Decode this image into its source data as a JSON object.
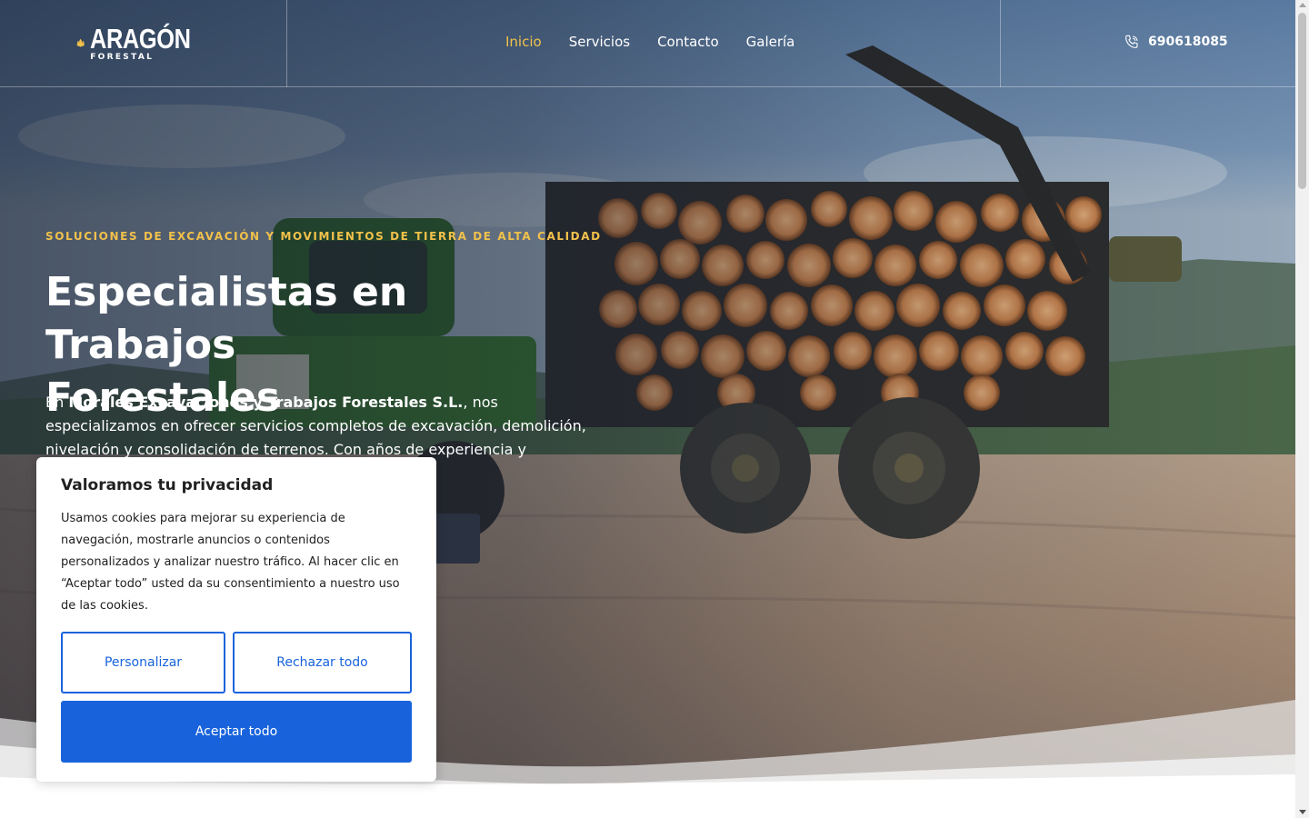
{
  "brand": {
    "name": "ARAGÓN",
    "tagline": "FORESTAL",
    "accent_color": "#f2c14b"
  },
  "nav": {
    "items": [
      {
        "label": "Inicio",
        "active": true
      },
      {
        "label": "Servicios",
        "active": false
      },
      {
        "label": "Contacto",
        "active": false
      },
      {
        "label": "Galería",
        "active": false
      }
    ]
  },
  "contact": {
    "phone": "690618085",
    "icon": "phone-icon"
  },
  "hero": {
    "eyebrow": "SOLUCIONES DE EXCAVACIÓN Y MOVIMIENTOS DE TIERRA DE ALTA CALIDAD",
    "title_line1": "Especialistas en Trabajos",
    "title_line2": "Forestales",
    "desc_prefix": "En ",
    "desc_company": "Morales Excavaciones y Trabajos Forestales S.L.",
    "desc_rest": ", nos especializamos en ofrecer servicios completos de excavación, demolición, nivelación y consolidación de terrenos. Con años de experiencia y maquinaria de última"
  },
  "cookie_banner": {
    "title": "Valoramos tu privacidad",
    "text": "Usamos cookies para mejorar su experiencia de navegación, mostrarle anuncios o contenidos personalizados y analizar nuestro tráfico. Al hacer clic en “Aceptar todo” usted da su consentimiento a nuestro uso de las cookies.",
    "customize_label": "Personalizar",
    "reject_label": "Rechazar todo",
    "accept_label": "Aceptar todo",
    "primary_color": "#1863dc"
  }
}
